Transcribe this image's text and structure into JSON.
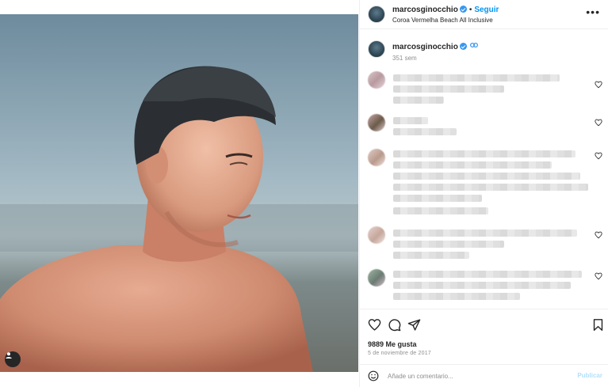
{
  "post": {
    "username": "marcosginocchio",
    "follow_label": "Seguir",
    "separator": "•",
    "location": "Coroa Vermelha Beach All Inclusive",
    "more_icon": "more-horizontal-icon",
    "caption_time": "351 sem",
    "caption_emoji_icon": "emoji-icon"
  },
  "engagement": {
    "likes": "9889 Me gusta",
    "date": "5 de noviembre de 2017"
  },
  "comment_box": {
    "placeholder": "Añade un comentario...",
    "publish_label": "Publicar"
  },
  "icons": {
    "like": "heart-icon",
    "comment": "comment-icon",
    "share": "share-icon",
    "save": "bookmark-icon",
    "emoji": "smiley-icon",
    "user_tag": "user-tag-icon"
  },
  "colors": {
    "accent": "#0095f6",
    "verified": "#3897f0",
    "muted": "#8e8e8e",
    "publish_disabled": "#b2dffc"
  }
}
